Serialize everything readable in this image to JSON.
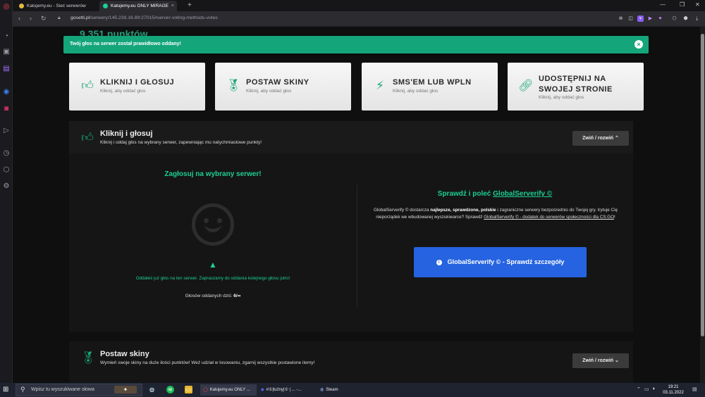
{
  "browser": {
    "tabs": [
      {
        "label": "Katujemy.eu - Sieć serwerów",
        "active": false
      },
      {
        "label": "Katujemy.eu ONLY MIRAGE",
        "active": true
      }
    ],
    "new_tab": "+",
    "url_host": "gosetti.pl",
    "url_path": "/serwery/145.239.16.89:27015#server-voting-methods-votes"
  },
  "page": {
    "points_behind": "9 351 punktów",
    "alert": {
      "text": "Twój głos na serwer został prawidłowo oddany!",
      "close": "×"
    },
    "cards": [
      {
        "title": "KLIKNIJ I GŁOSUJ",
        "sub": "Kliknij, aby oddać głos",
        "icon": "thumbs-up-icon"
      },
      {
        "title": "POSTAW SKINY",
        "sub": "Kliknij, aby oddać głos",
        "icon": "award-icon"
      },
      {
        "title": "SMS'EM LUB WPLN",
        "sub": "Kliknij, aby oddać głos",
        "icon": "bolt-icon"
      },
      {
        "title": "UDOSTĘPNIJ NA SWOJEJ STRONIE",
        "sub": "Kliknij, aby oddać głos",
        "icon": "link-icon"
      }
    ],
    "vote_panel": {
      "title": "Kliknij i głosuj",
      "subtitle": "Kliknij i oddaj głos na wybrany serwer, zapewniając mu natychmiastowe punkty!",
      "toggle": "Zwiń / rozwiń",
      "vote_heading": "Zagłosuj na wybrany serwer!",
      "warning": "Oddałeś już głos na ten serwer. Zapraszamy do oddania kolejnego głosu jutro!",
      "votes_today_label": "Głosów oddanych dziś:",
      "votes_today_value": "6/∞",
      "gs_heading_prefix": "Sprawdź i poleć",
      "gs_heading_link": "GlobalServerify ©",
      "gs_desc_1": "GlobalServerify © dostarcza",
      "gs_desc_bold": "najlepsze, sprawdzone, polskie",
      "gs_desc_2": "i zagraniczne serwery bezpośrednio do Twojej gry. Irytuje Cię nieporządek we wbudowanej wyszukiwarce? Sprawdź",
      "gs_desc_link": "GlobalServerify © - dodatek do serwerów społeczności dla CS:GO",
      "gs_desc_end": "!",
      "gs_button": "GlobalServerify © - Sprawdź szczegóły"
    },
    "skins_panel": {
      "title": "Postaw skiny",
      "subtitle": "Wymień swoje skiny na duże ilości punktów! Weź udział w losowaniu, zgarnij wszystkie postawione itemy!",
      "toggle": "Zwiń / rozwiń"
    }
  },
  "taskbar": {
    "search_placeholder": "Wpisz tu wyszukiwane słowa",
    "apps": [
      {
        "label": "Katujemy.eu ONLY ..."
      },
      {
        "label": "#①|luźny|① | ... -..."
      },
      {
        "label": "Steam"
      }
    ],
    "time": "19:21",
    "date": "03.11.2022"
  },
  "colors": {
    "accent_green": "#1ccf94",
    "alert_green": "#15a57a",
    "button_blue": "#2563e0"
  }
}
